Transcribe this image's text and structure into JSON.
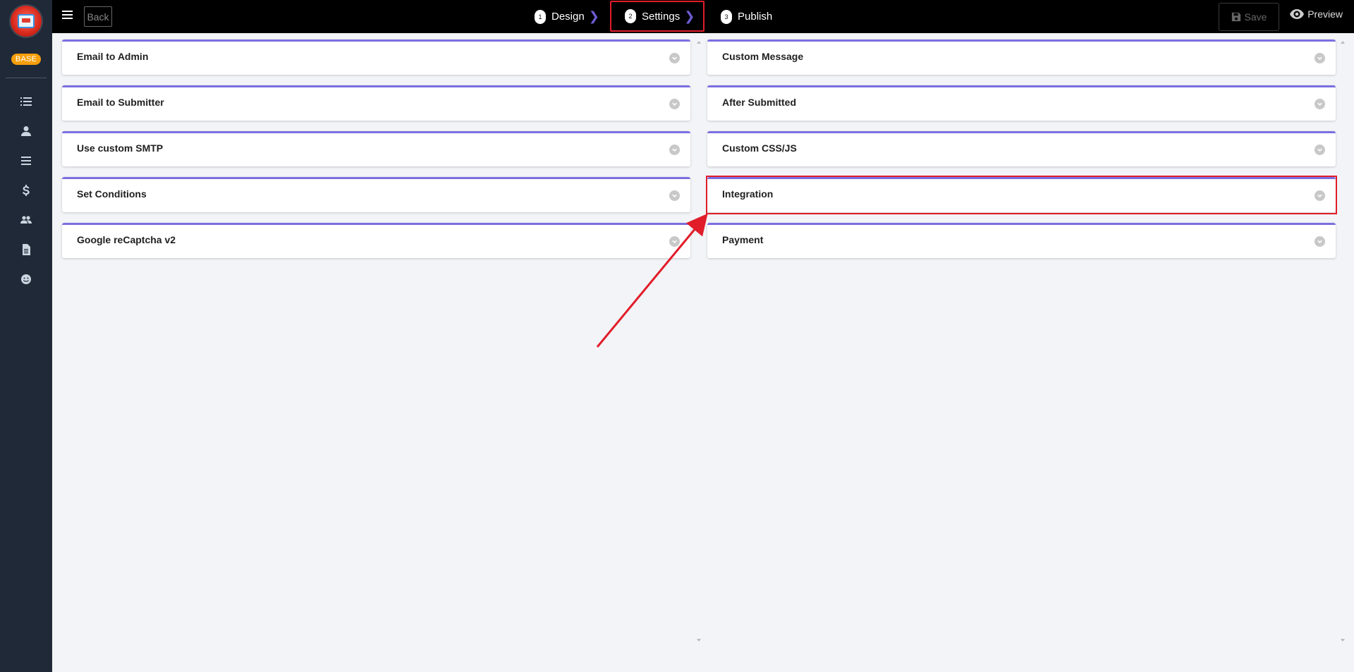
{
  "sidebar": {
    "badge": "BASE",
    "icons": [
      "list-icon",
      "user-icon",
      "menu-icon",
      "dollar-icon",
      "users-icon",
      "file-icon",
      "smile-icon"
    ]
  },
  "topbar": {
    "back_label": "Back",
    "steps": [
      {
        "number": "1",
        "label": "Design"
      },
      {
        "number": "2",
        "label": "Settings"
      },
      {
        "number": "3",
        "label": "Publish"
      }
    ],
    "active_step": "Settings",
    "save_label": "Save",
    "preview_label": "Preview"
  },
  "left_panels": [
    {
      "title": "Email to Admin"
    },
    {
      "title": "Email to Submitter"
    },
    {
      "title": "Use custom SMTP"
    },
    {
      "title": "Set Conditions"
    },
    {
      "title": "Google reCaptcha v2"
    }
  ],
  "right_panels": [
    {
      "title": "Custom Message"
    },
    {
      "title": "After Submitted"
    },
    {
      "title": "Custom CSS/JS"
    },
    {
      "title": "Integration"
    },
    {
      "title": "Payment"
    }
  ],
  "highlighted_panel": "Integration",
  "colors": {
    "panel_accent": "#7b6fe0",
    "annotation_red": "#e11d2a",
    "sidebar_bg": "#1f2937",
    "badge_bg": "#f59e0b"
  }
}
